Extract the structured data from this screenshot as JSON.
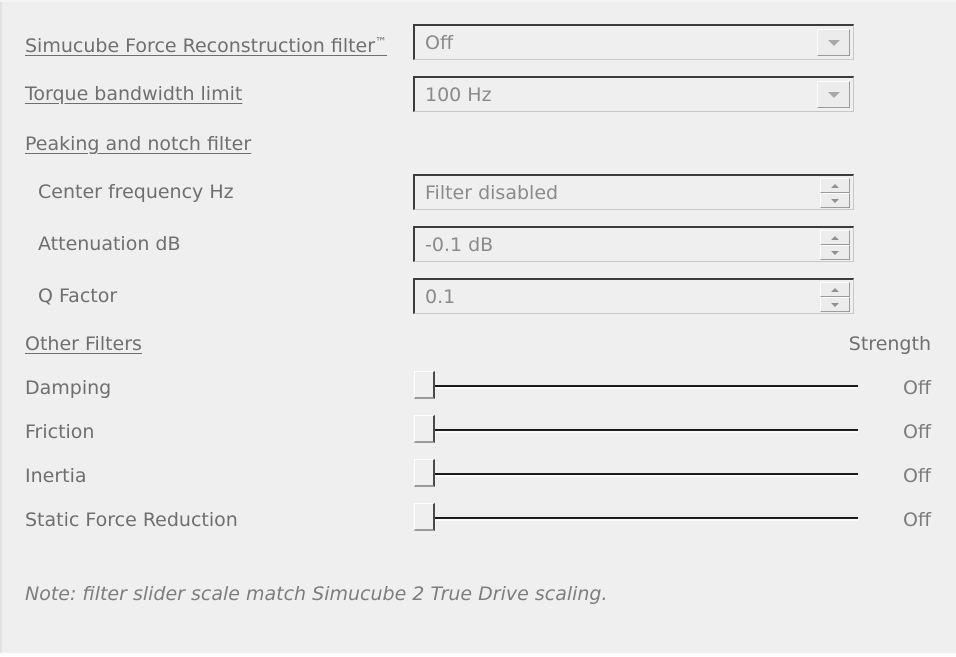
{
  "settings_rows": [
    {
      "label": "Simucube Force Reconstruction filter",
      "trademark": "™",
      "control": "dropdown",
      "value": "Off"
    },
    {
      "label": "Torque bandwidth limit",
      "control": "dropdown",
      "value": "100 Hz"
    }
  ],
  "sections": {
    "peaking_notch": {
      "title": "Peaking and notch filter",
      "rows": [
        {
          "label": "Center frequency Hz",
          "control": "spinbox",
          "value": "Filter disabled"
        },
        {
          "label": "Attenuation dB",
          "control": "spinbox",
          "value": "-0.1 dB"
        },
        {
          "label": "Q Factor",
          "control": "spinbox",
          "value": "0.1"
        }
      ]
    },
    "other_filters": {
      "title": "Other Filters",
      "strength_header": "Strength",
      "rows": [
        {
          "label": "Damping",
          "control": "slider",
          "value": "Off",
          "position_percent": 0
        },
        {
          "label": "Friction",
          "control": "slider",
          "value": "Off",
          "position_percent": 0
        },
        {
          "label": "Inertia",
          "control": "slider",
          "value": "Off",
          "position_percent": 0
        },
        {
          "label": "Static Force Reduction",
          "control": "slider",
          "value": "Off",
          "position_percent": 0
        }
      ]
    }
  },
  "note": "Note: filter slider scale match Simucube 2 True Drive scaling.",
  "colors": {
    "background": "#efefef",
    "label_text": "#6f6f6f",
    "value_text": "#8b8b8b",
    "field_border_dark": "#3c3c3c",
    "groove": "#1c1c1c"
  }
}
